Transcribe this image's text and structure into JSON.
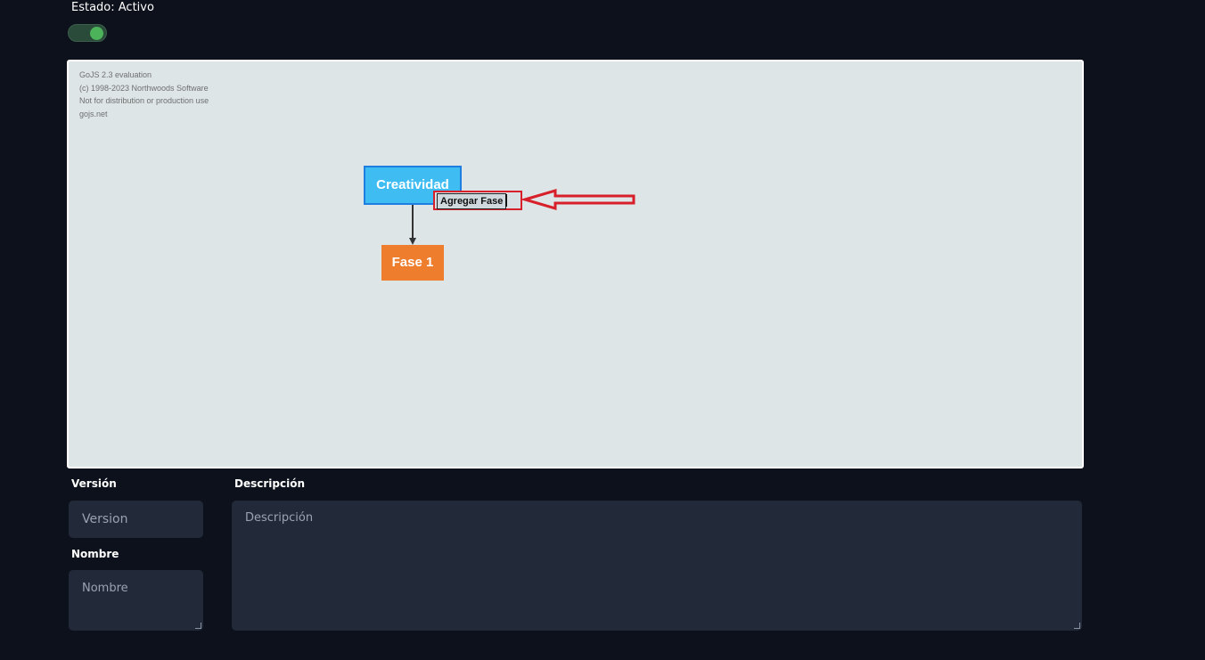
{
  "status": {
    "label": "Estado: Activo",
    "active": true
  },
  "diagram": {
    "watermark": [
      "GoJS 2.3 evaluation",
      "(c) 1998-2023 Northwoods Software",
      "Not for distribution or production use",
      "gojs.net"
    ],
    "root_node": {
      "label": "Creatividad",
      "color": "#3fbdf2"
    },
    "child_node": {
      "label": "Fase 1",
      "color": "#ee7d2e"
    },
    "add_phase_button": {
      "label": "Agregar Fase"
    },
    "highlight_color": "#d7202a"
  },
  "form": {
    "version": {
      "label": "Versión",
      "placeholder": "Version"
    },
    "nombre": {
      "label": "Nombre",
      "placeholder": "Nombre"
    },
    "descripcion": {
      "label": "Descripción",
      "placeholder": "Descripción"
    }
  }
}
